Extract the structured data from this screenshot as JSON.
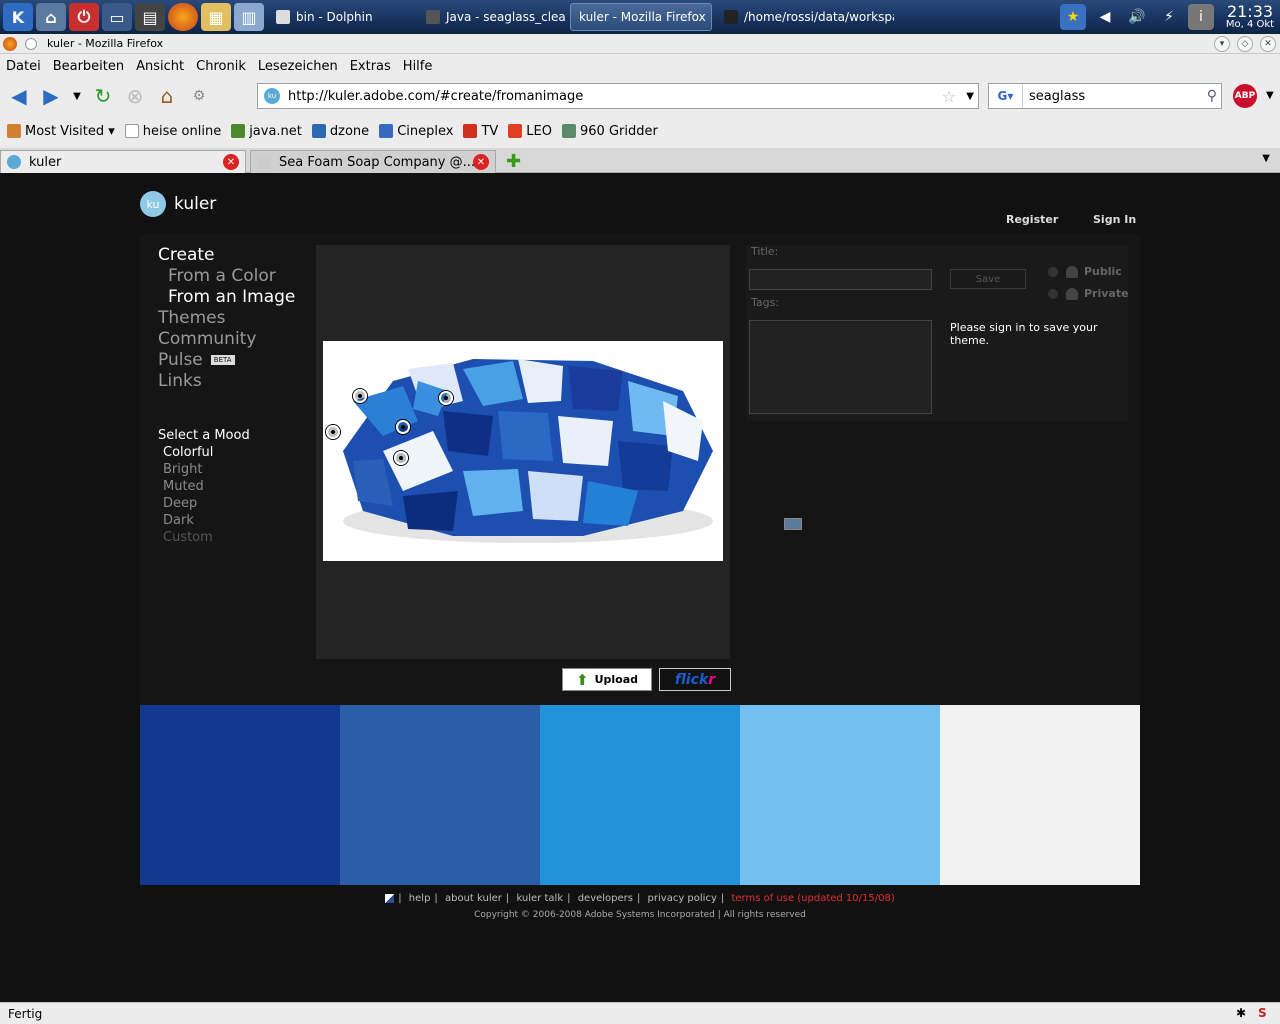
{
  "taskbar": {
    "tasks": [
      {
        "label": "bin - Dolphin",
        "active": false
      },
      {
        "label": "Java - seaglass_clean/src/...",
        "active": false
      },
      {
        "label": "kuler - Mozilla Firefox",
        "active": true
      },
      {
        "label": "/home/rossi/data/workspac",
        "active": false
      }
    ],
    "clock_time": "21:33",
    "clock_date": "Mo, 4 Okt"
  },
  "window": {
    "title": "kuler - Mozilla Firefox"
  },
  "menu": [
    "Datei",
    "Bearbeiten",
    "Ansicht",
    "Chronik",
    "Lesezeichen",
    "Extras",
    "Hilfe"
  ],
  "urlbar": {
    "url": "http://kuler.adobe.com/#create/fromanimage",
    "favicon": "ku"
  },
  "search": {
    "value": "seaglass",
    "engine_label": "G"
  },
  "abp_label": "ABP",
  "bookmarks": [
    {
      "label": "Most Visited ▾",
      "color": "#d08030"
    },
    {
      "label": "heise online",
      "color": "#ffffff"
    },
    {
      "label": "java.net",
      "color": "#4a8a2a"
    },
    {
      "label": "dzone",
      "color": "#2a6ab0"
    },
    {
      "label": "Cineplex",
      "color": "#3a6ac0"
    },
    {
      "label": "TV",
      "color": "#d03020"
    },
    {
      "label": "LEO",
      "color": "#e04020"
    },
    {
      "label": "960 Gridder",
      "color": "#5a8a6a"
    }
  ],
  "tabs": [
    {
      "label": "kuler",
      "active": true
    },
    {
      "label": "Sea Foam Soap Company @...",
      "active": false
    }
  ],
  "page": {
    "logo_badge": "ku",
    "logo_name": "kuler",
    "register": "Register",
    "signin": "Sign In",
    "nav": {
      "create": "Create",
      "from_color": "From a Color",
      "from_image": "From an Image",
      "themes": "Themes",
      "community": "Community",
      "pulse": "Pulse",
      "beta": "BETA",
      "links": "Links"
    },
    "mood": {
      "heading": "Select a Mood",
      "items": [
        "Colorful",
        "Bright",
        "Muted",
        "Deep",
        "Dark",
        "Custom"
      ],
      "selected": "Colorful"
    },
    "form": {
      "title_label": "Title:",
      "tags_label": "Tags:",
      "save": "Save",
      "public": "Public",
      "private": "Private",
      "signin_message": "Please sign in to save your theme."
    },
    "upload": "Upload",
    "flickr_a": "flick",
    "flickr_b": "r",
    "swatches": [
      "#12388f",
      "#2b5ea8",
      "#2293d8",
      "#73bff0",
      "#f1f1f1"
    ],
    "footer": {
      "links": [
        "help",
        "about kuler",
        "kuler talk",
        "developers",
        "privacy policy"
      ],
      "terms": "terms of use (updated 10/15/08)",
      "copyright": "Copyright © 2006-2008 Adobe Systems Incorporated | All rights reserved"
    }
  },
  "status": "Fertig"
}
